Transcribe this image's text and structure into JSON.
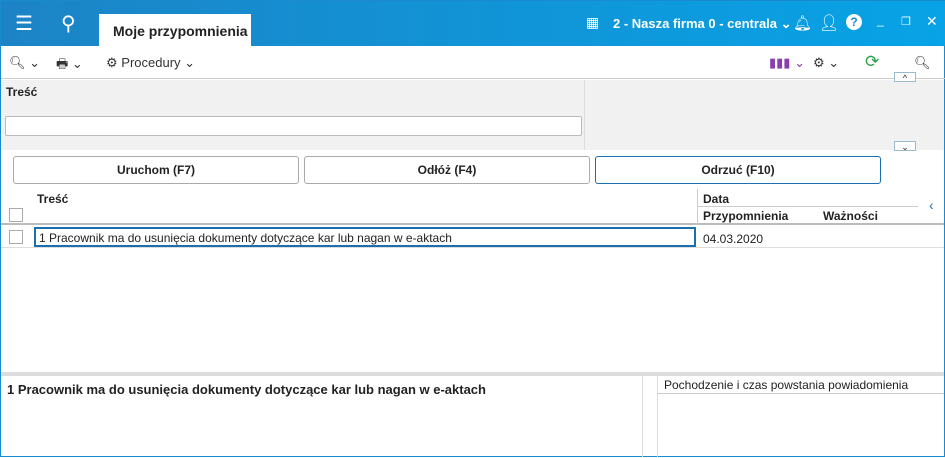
{
  "header": {
    "tab": "Moje przypomnienia",
    "firm": "2 - Nasza firma 0 - centrala"
  },
  "toolbar": {
    "procedury": "Procedury"
  },
  "filter": {
    "label": "Treść",
    "value": ""
  },
  "buttons": {
    "run": "Uruchom (F7)",
    "postpone": "Odłóż (F4)",
    "reject": "Odrzuć (F10)"
  },
  "table": {
    "col_content": "Treść",
    "col_date": "Data",
    "col_reminder": "Przypomnienia",
    "col_validity": "Ważności",
    "rows": [
      {
        "content": "1 Pracownik ma do usunięcia dokumenty dotyczące kar lub nagan w e-aktach",
        "reminder": "04.03.2020",
        "validity": ""
      }
    ]
  },
  "detail": {
    "title": "1 Pracownik ma do usunięcia dokumenty dotyczące kar lub nagan w e-aktach",
    "origin": "Pochodzenie i czas powstania powiadomienia"
  }
}
